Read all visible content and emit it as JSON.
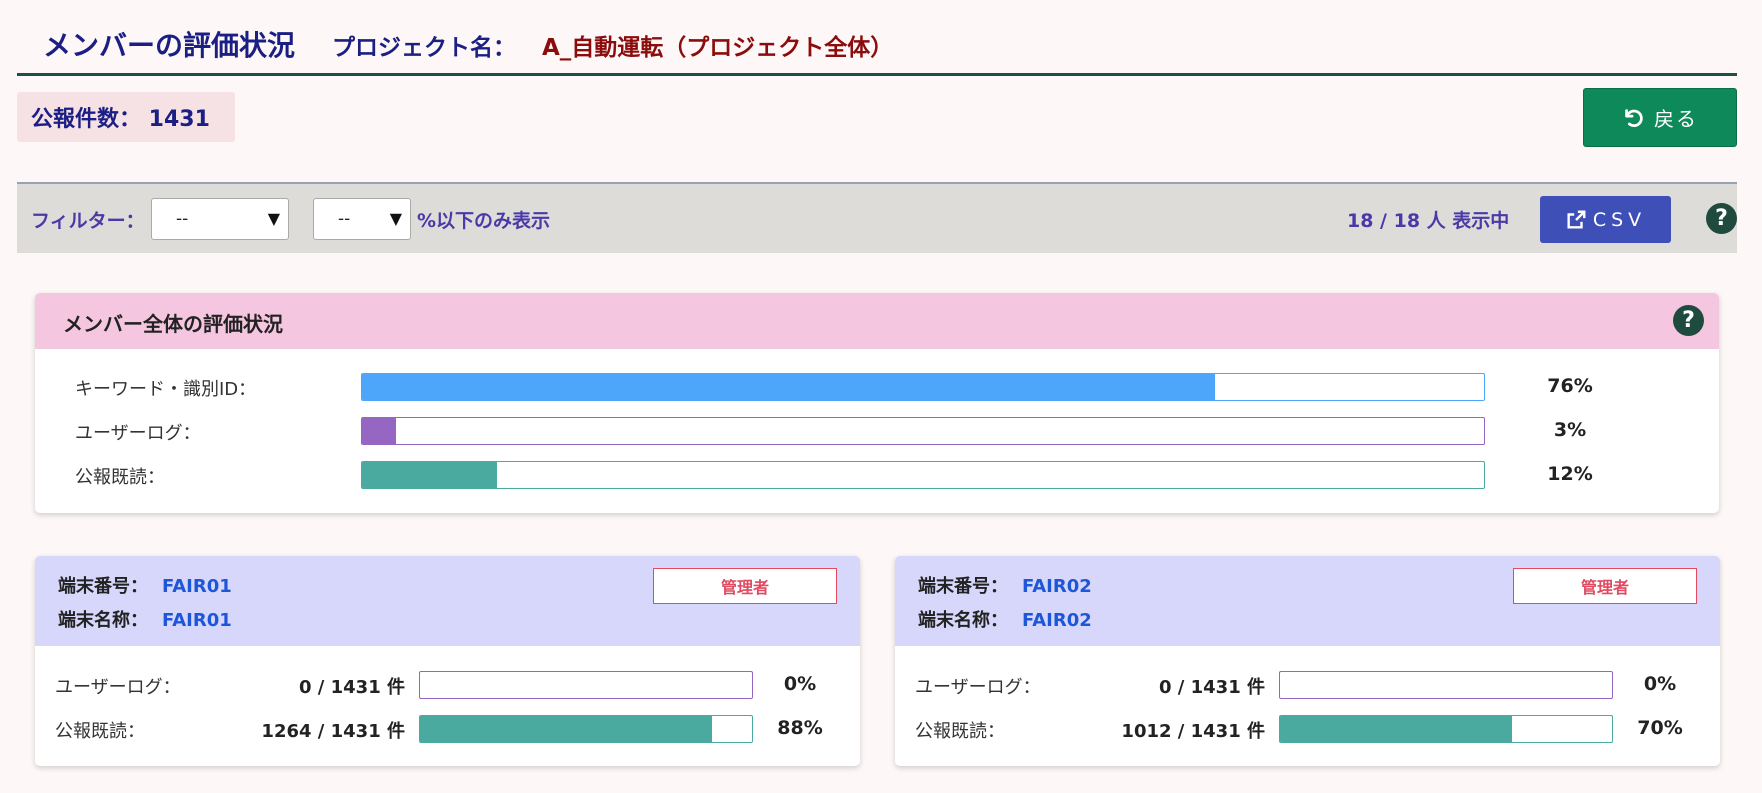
{
  "header": {
    "title": "メンバーの評価状況",
    "project_label": "プロジェクト名：",
    "project_name": "A_自動運転（プロジェクト全体）"
  },
  "summary": {
    "count_text": "公報件数： 1431"
  },
  "back_button": {
    "label": "戻る",
    "icon": "undo-icon"
  },
  "filter": {
    "label": "フィルター：",
    "select1_value": "--",
    "select2_value": "--",
    "suffix": "%以下のみ表示",
    "display_count": "18 / 18 人 表示中",
    "csv_label": "CSV",
    "csv_icon": "external-link-icon"
  },
  "overall": {
    "title": "メンバー全体の評価状況",
    "rows": [
      {
        "label": "キーワード・識別ID：",
        "percent": "76%",
        "value": 76,
        "fill_color": "#4ea6fb",
        "border_color": "#4ea6fb"
      },
      {
        "label": "ユーザーログ：",
        "percent": "3%",
        "value": 3,
        "fill_color": "#9567c2",
        "border_color": "#9567c2"
      },
      {
        "label": "公報既読：",
        "percent": "12%",
        "value": 12,
        "fill_color": "#4aaaa0",
        "border_color": "#4aaaa0"
      }
    ]
  },
  "members": [
    {
      "terminal_number_label": "端末番号：",
      "terminal_number": "FAIR01",
      "terminal_name_label": "端末名称：",
      "terminal_name": "FAIR01",
      "badge": "管理者",
      "rows": [
        {
          "label": "ユーザーログ：",
          "count": "0 / 1431 件",
          "percent": "0%",
          "value": 0,
          "fill_color": "#9567c2"
        },
        {
          "label": "公報既読：",
          "count": "1264 / 1431 件",
          "percent": "88%",
          "value": 88,
          "fill_color": "#4aaaa0"
        }
      ]
    },
    {
      "terminal_number_label": "端末番号：",
      "terminal_number": "FAIR02",
      "terminal_name_label": "端末名称：",
      "terminal_name": "FAIR02",
      "badge": "管理者",
      "rows": [
        {
          "label": "ユーザーログ：",
          "count": "0 / 1431 件",
          "percent": "0%",
          "value": 0,
          "fill_color": "#9567c2"
        },
        {
          "label": "公報既読：",
          "count": "1012 / 1431 件",
          "percent": "70%",
          "value": 70,
          "fill_color": "#4aaaa0"
        }
      ]
    }
  ]
}
